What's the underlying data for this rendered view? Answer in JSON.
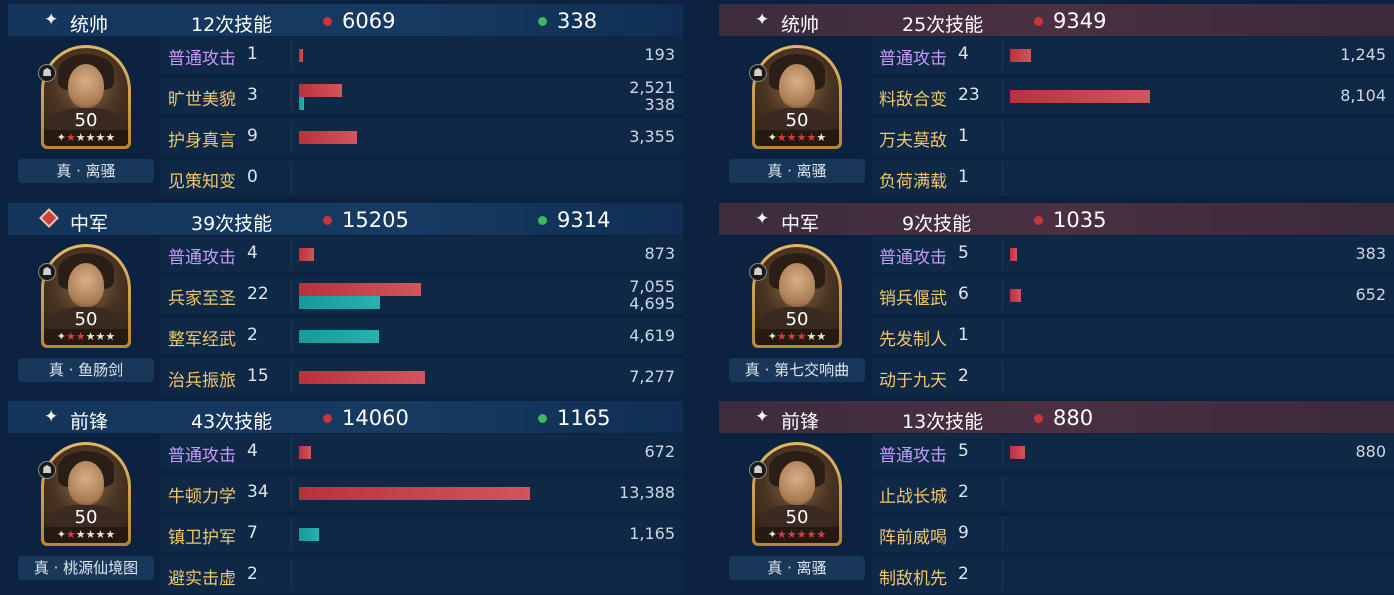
{
  "colors": {
    "damage": "#c8353f",
    "heal": "#3fb55c",
    "basic_skill": "#c79af5",
    "skill": "#f0c76a",
    "heal_bar": "#169a9a"
  },
  "sides": [
    {
      "id": "left",
      "generals": [
        {
          "position": "统帅",
          "position_icon": "sparkle-icon",
          "skill_count": "12次技能",
          "damage": "6069",
          "heal": "338",
          "level": "50",
          "stars_red": 1,
          "stars_total": 5,
          "treasure": "真 · 离骚",
          "skills": [
            {
              "name": "普通攻击",
              "times": "1",
              "basic": true,
              "damage": "193",
              "heal": "",
              "damage_value": 193,
              "heal_value": 0
            },
            {
              "name": "旷世美貌",
              "times": "3",
              "basic": false,
              "damage": "2,521",
              "heal": "338",
              "damage_value": 2521,
              "heal_value": 338
            },
            {
              "name": "护身真言",
              "times": "9",
              "basic": false,
              "damage": "3,355",
              "heal": "",
              "damage_value": 3355,
              "heal_value": 0
            },
            {
              "name": "见策知变",
              "times": "0",
              "basic": false,
              "damage": "",
              "heal": "",
              "damage_value": 0,
              "heal_value": 0
            }
          ]
        },
        {
          "position": "中军",
          "position_icon": "sword-emblem-icon",
          "skill_count": "39次技能",
          "damage": "15205",
          "heal": "9314",
          "level": "50",
          "stars_red": 2,
          "stars_total": 5,
          "treasure": "真 · 鱼肠剑",
          "skills": [
            {
              "name": "普通攻击",
              "times": "4",
              "basic": true,
              "damage": "873",
              "heal": "",
              "damage_value": 873,
              "heal_value": 0
            },
            {
              "name": "兵家至圣",
              "times": "22",
              "basic": false,
              "damage": "7,055",
              "heal": "4,695",
              "damage_value": 7055,
              "heal_value": 4695
            },
            {
              "name": "整军经武",
              "times": "2",
              "basic": false,
              "damage": "",
              "heal": "4,619",
              "damage_value": 0,
              "heal_value": 4619
            },
            {
              "name": "治兵振旅",
              "times": "15",
              "basic": false,
              "damage": "7,277",
              "heal": "",
              "damage_value": 7277,
              "heal_value": 0
            }
          ]
        },
        {
          "position": "前锋",
          "position_icon": "sparkle-icon",
          "skill_count": "43次技能",
          "damage": "14060",
          "heal": "1165",
          "level": "50",
          "stars_red": 1,
          "stars_total": 5,
          "treasure": "真 · 桃源仙境图",
          "skills": [
            {
              "name": "普通攻击",
              "times": "4",
              "basic": true,
              "damage": "672",
              "heal": "",
              "damage_value": 672,
              "heal_value": 0
            },
            {
              "name": "牛顿力学",
              "times": "34",
              "basic": false,
              "damage": "13,388",
              "heal": "",
              "damage_value": 13388,
              "heal_value": 0
            },
            {
              "name": "镇卫护军",
              "times": "7",
              "basic": false,
              "damage": "",
              "heal": "1,165",
              "damage_value": 0,
              "heal_value": 1165
            },
            {
              "name": "避实击虚",
              "times": "2",
              "basic": false,
              "damage": "",
              "heal": "",
              "damage_value": 0,
              "heal_value": 0
            }
          ]
        }
      ]
    },
    {
      "id": "right",
      "generals": [
        {
          "position": "统帅",
          "position_icon": "sparkle-icon",
          "skill_count": "25次技能",
          "damage": "9349",
          "heal": "",
          "level": "50",
          "stars_red": 4,
          "stars_total": 5,
          "treasure": "真 · 离骚",
          "skills": [
            {
              "name": "普通攻击",
              "times": "4",
              "basic": true,
              "damage": "1,245",
              "heal": "",
              "damage_value": 1245,
              "heal_value": 0
            },
            {
              "name": "料敌合变",
              "times": "23",
              "basic": false,
              "damage": "8,104",
              "heal": "",
              "damage_value": 8104,
              "heal_value": 0
            },
            {
              "name": "万夫莫敌",
              "times": "1",
              "basic": false,
              "damage": "",
              "heal": "",
              "damage_value": 0,
              "heal_value": 0
            },
            {
              "name": "负荷满载",
              "times": "1",
              "basic": false,
              "damage": "",
              "heal": "",
              "damage_value": 0,
              "heal_value": 0
            }
          ]
        },
        {
          "position": "中军",
          "position_icon": "sparkle-icon",
          "skill_count": "9次技能",
          "damage": "1035",
          "heal": "",
          "level": "50",
          "stars_red": 3,
          "stars_total": 5,
          "treasure": "真 · 第七交响曲",
          "skills": [
            {
              "name": "普通攻击",
              "times": "5",
              "basic": true,
              "damage": "383",
              "heal": "",
              "damage_value": 383,
              "heal_value": 0
            },
            {
              "name": "销兵偃武",
              "times": "6",
              "basic": false,
              "damage": "652",
              "heal": "",
              "damage_value": 652,
              "heal_value": 0
            },
            {
              "name": "先发制人",
              "times": "1",
              "basic": false,
              "damage": "",
              "heal": "",
              "damage_value": 0,
              "heal_value": 0
            },
            {
              "name": "动于九天",
              "times": "2",
              "basic": false,
              "damage": "",
              "heal": "",
              "damage_value": 0,
              "heal_value": 0
            }
          ]
        },
        {
          "position": "前锋",
          "position_icon": "sparkle-icon",
          "skill_count": "13次技能",
          "damage": "880",
          "heal": "",
          "level": "50",
          "stars_red": 5,
          "stars_total": 5,
          "treasure": "真 · 离骚",
          "skills": [
            {
              "name": "普通攻击",
              "times": "5",
              "basic": true,
              "damage": "880",
              "heal": "",
              "damage_value": 880,
              "heal_value": 0
            },
            {
              "name": "止战长城",
              "times": "2",
              "basic": false,
              "damage": "",
              "heal": "",
              "damage_value": 0,
              "heal_value": 0
            },
            {
              "name": "阵前威喝",
              "times": "9",
              "basic": false,
              "damage": "",
              "heal": "",
              "damage_value": 0,
              "heal_value": 0
            },
            {
              "name": "制敌机先",
              "times": "2",
              "basic": false,
              "damage": "",
              "heal": "",
              "damage_value": 0,
              "heal_value": 0
            }
          ]
        }
      ]
    }
  ]
}
